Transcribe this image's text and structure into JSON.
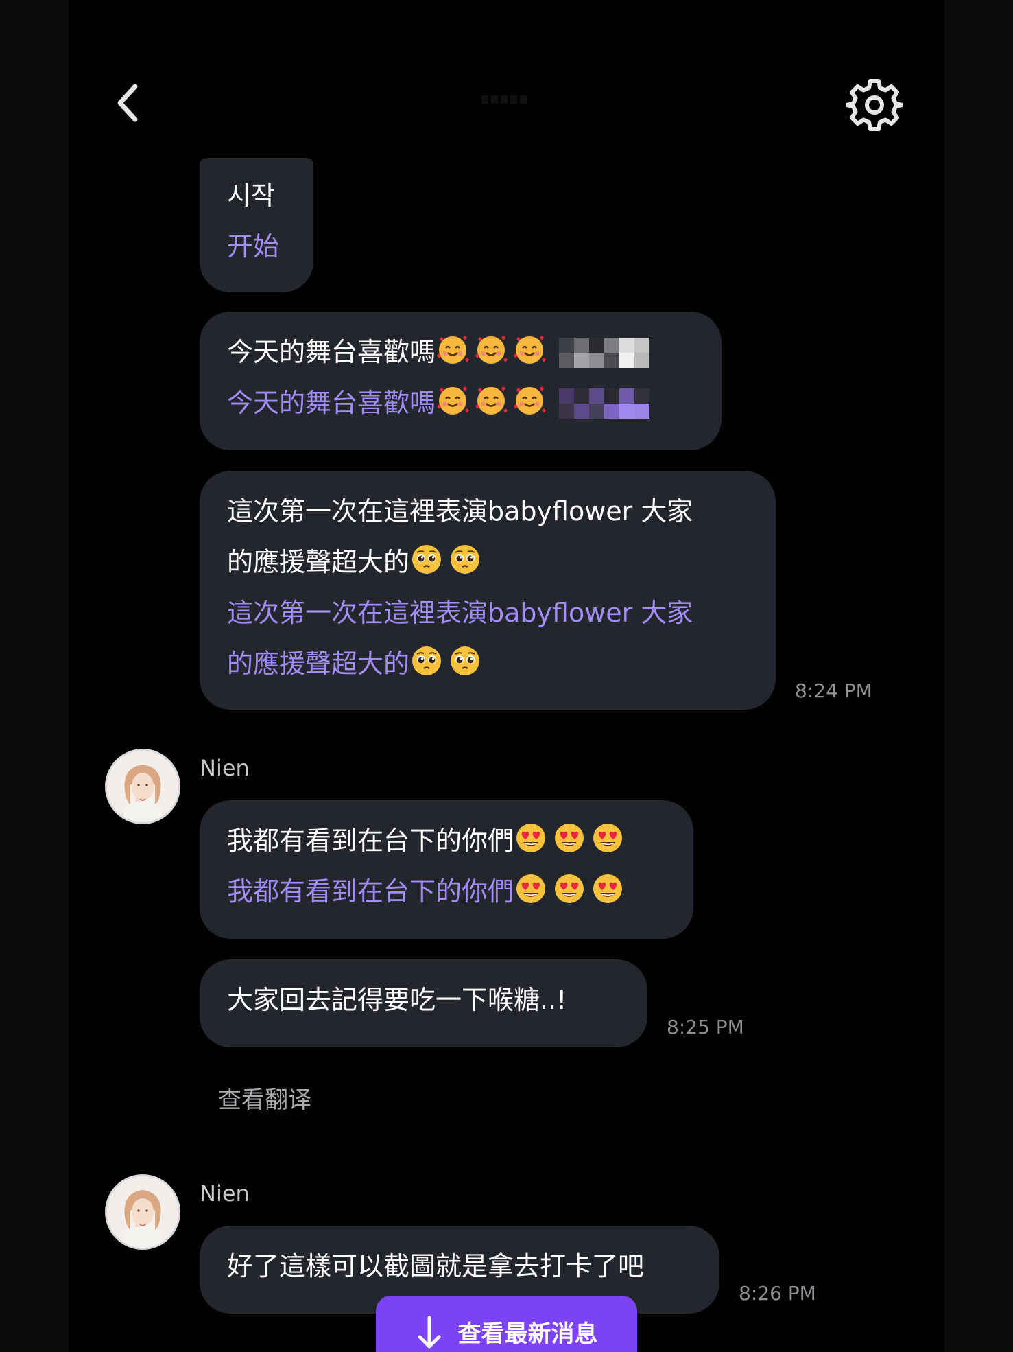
{
  "header": {
    "back_icon": "chevron-left-icon",
    "settings_icon": "gear-icon"
  },
  "messages": [
    {
      "original": "시작",
      "translation": "开始"
    },
    {
      "original": "今天的舞台喜歡嗎",
      "translation": "今天的舞台喜歡嗎",
      "emoji": "smiling-face-with-hearts-icon"
    },
    {
      "original_line1": "這次第一次在這裡表演babyflower 大家",
      "original_line2": "的應援聲超大的",
      "translation_line1": "這次第一次在這裡表演babyflower 大家",
      "translation_line2": "的應援聲超大的",
      "emoji": "pleading-face-icon",
      "time": "8:24 PM"
    }
  ],
  "group2": {
    "sender": "Nien",
    "messages": [
      {
        "original": "我都有看到在台下的你們",
        "translation": "我都有看到在台下的你們",
        "emoji": "heart-eyes-icon"
      },
      {
        "original": "大家回去記得要吃一下喉糖..!",
        "time": "8:25 PM"
      }
    ],
    "see_translation": "查看翻译"
  },
  "group3": {
    "sender": "Nien",
    "message": "好了這樣可以截圖就是拿去打卡了吧",
    "time": "8:26 PM"
  },
  "new_messages_button": {
    "label": "查看最新消息",
    "icon": "arrow-down-icon"
  },
  "colors": {
    "background": "#000000",
    "bubble": "#24262d",
    "translation_text": "#a28cf6",
    "accent": "#7b42f6"
  }
}
